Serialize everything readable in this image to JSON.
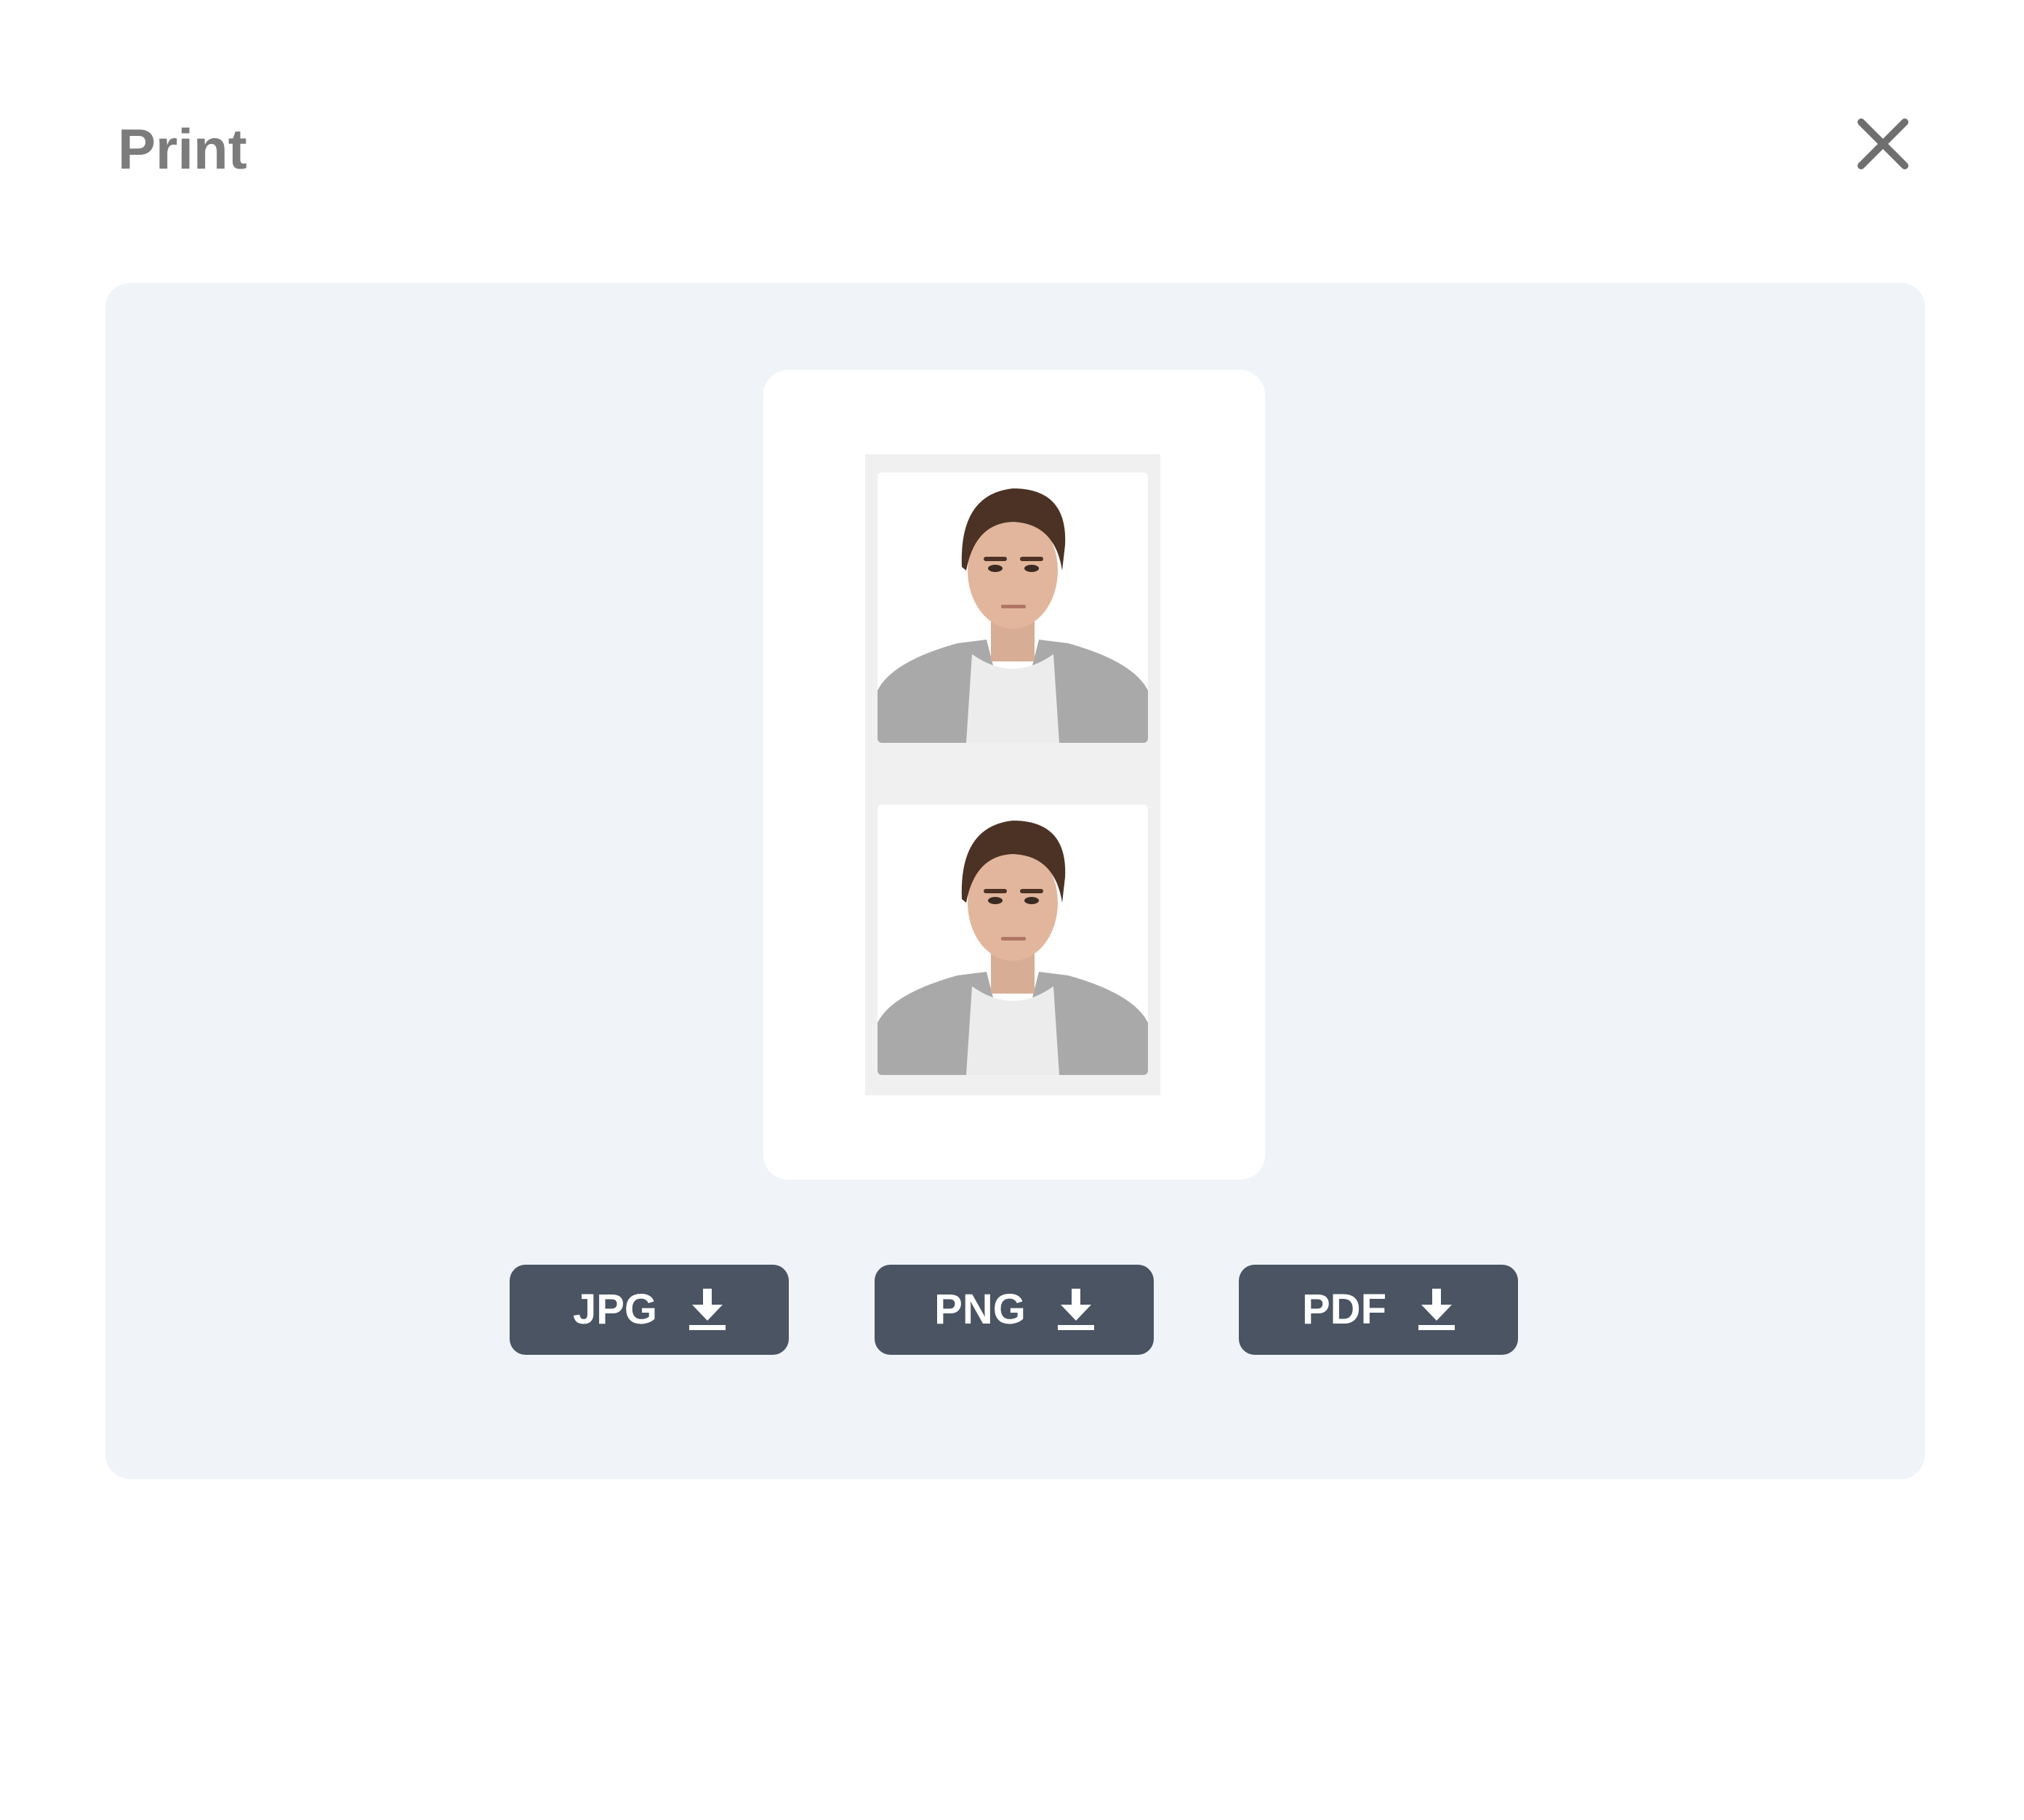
{
  "dialog": {
    "title": "Print"
  },
  "preview": {
    "photo_count": 2
  },
  "downloads": [
    {
      "label": "JPG",
      "icon": "download-icon"
    },
    {
      "label": "PNG",
      "icon": "download-icon"
    },
    {
      "label": "PDF",
      "icon": "download-icon"
    }
  ],
  "colors": {
    "title_text": "#7c7c7c",
    "close_icon": "#6f6f6f",
    "panel_background": "#f0f4f8",
    "button_background": "#4a5462",
    "button_text": "#ffffff"
  }
}
